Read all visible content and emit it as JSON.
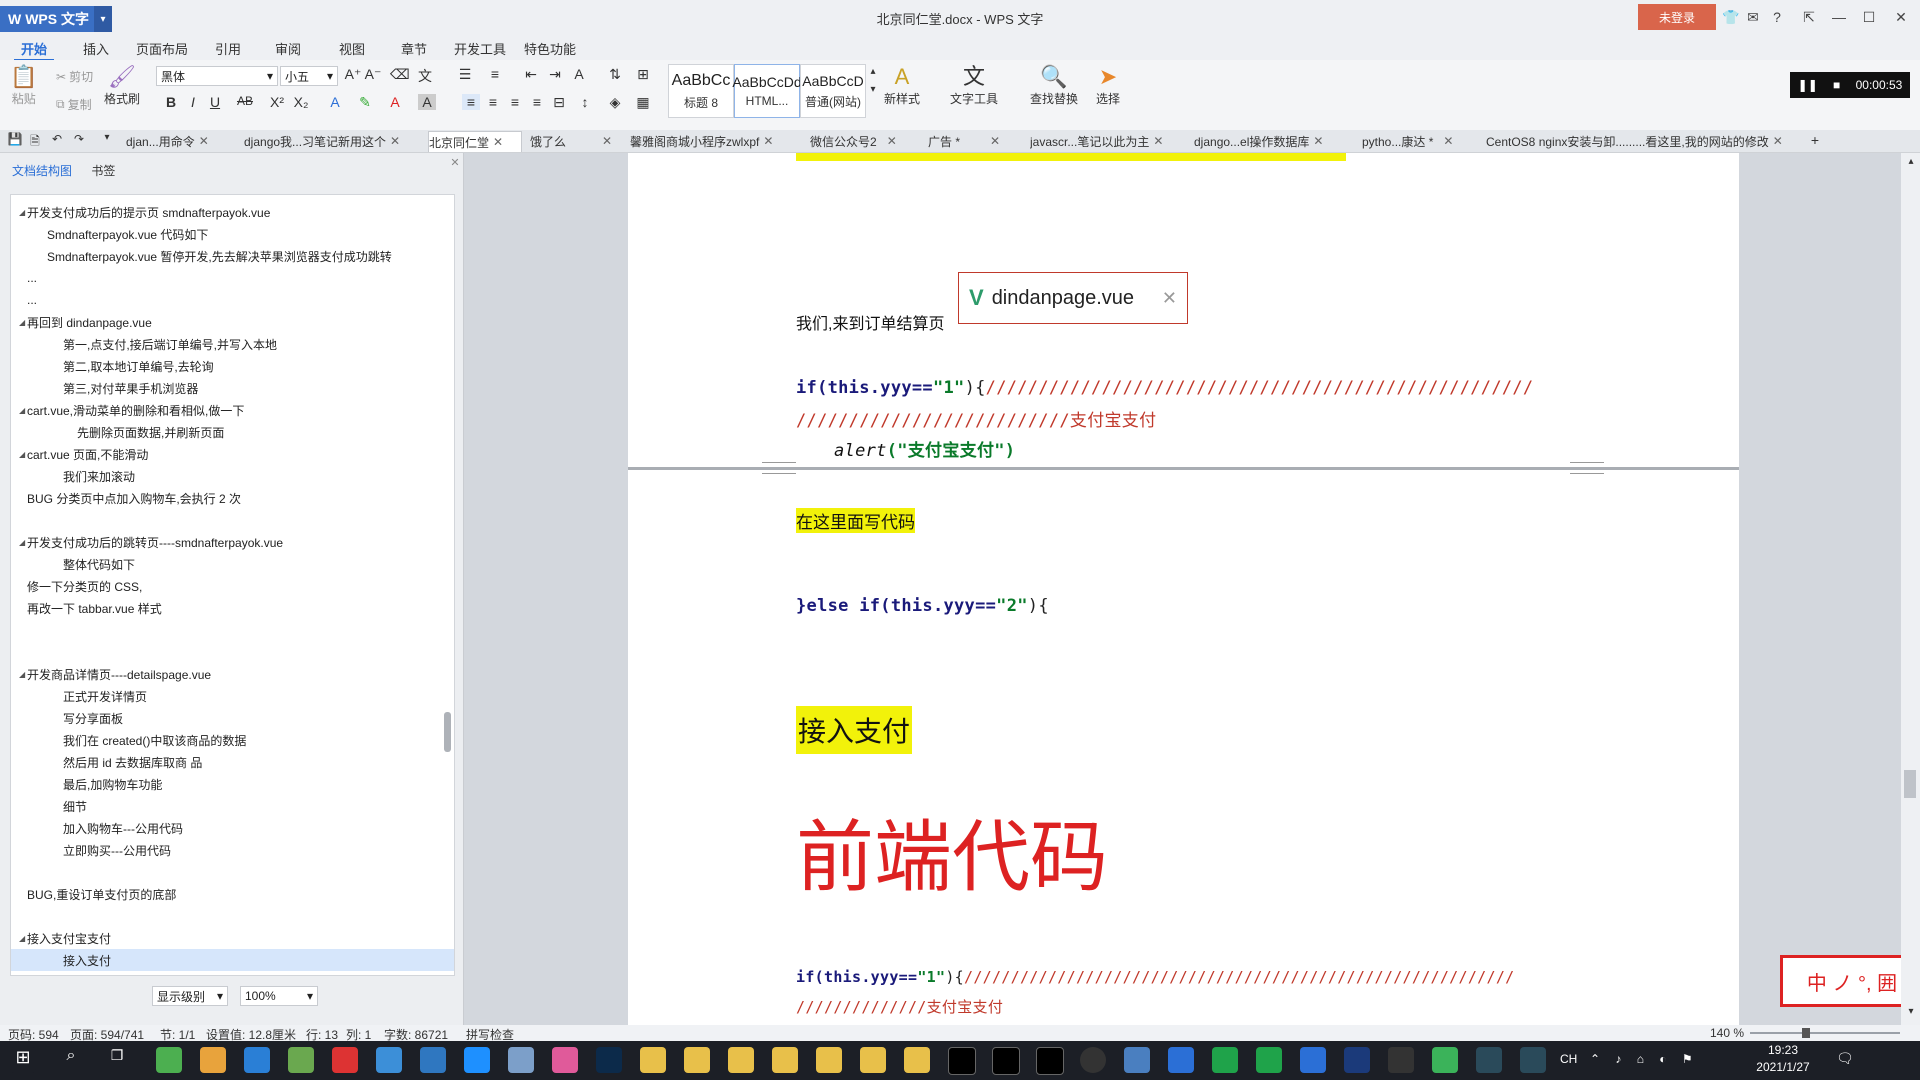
{
  "window": {
    "app_name": "WPS 文字",
    "title": "北京同仁堂.docx - WPS 文字",
    "login_label": "未登录"
  },
  "menu": {
    "tabs": [
      "开始",
      "插入",
      "页面布局",
      "引用",
      "审阅",
      "视图",
      "章节",
      "开发工具",
      "特色功能"
    ]
  },
  "ribbon": {
    "paste": "粘贴",
    "cut": "剪切",
    "copy": "复制",
    "format_painter": "格式刷",
    "font_name": "黑体",
    "font_size": "小五",
    "styles": [
      {
        "sample": "AaBbCc",
        "name": "标题 8"
      },
      {
        "sample": "AaBbCcDd",
        "name": "HTML..."
      },
      {
        "sample": "AaBbCcD",
        "name": "普通(网站)"
      }
    ],
    "new_style": "新样式",
    "text_tools": "文字工具",
    "find_replace": "查找替换",
    "select": "选择",
    "timer": "00:00:53"
  },
  "doc_tabs": [
    "djan...用命令",
    "django我...习笔记新用这个",
    "北京同仁堂",
    "饿了么",
    "馨雅阁商城小程序zwlxpf",
    "微信公众号2",
    "广告 *",
    "javascr...笔记以此为主",
    "django...el操作数据库",
    "pytho...康达 *",
    "CentOS8 nginx安装与卸.........看这里,我的网站的修改"
  ],
  "nav": {
    "tab_outline": "文档结构图",
    "tab_bookmark": "书签",
    "items": [
      {
        "text": "开发支付成功后的提示页        smdnafterpayok.vue",
        "level": 1,
        "expand": true
      },
      {
        "text": "Smdnafterpayok.vue 代码如下",
        "level": 2
      },
      {
        "text": "Smdnafterpayok.vue 暂停开发,先去解决苹果浏览器支付成功跳转",
        "level": 2
      },
      {
        "text": "...",
        "level": 1
      },
      {
        "text": "...",
        "level": 1
      },
      {
        "text": "再回到 dindanpage.vue",
        "level": 1,
        "expand": true
      },
      {
        "text": "第一,点支付,接后端订单编号,并写入本地",
        "level": 3
      },
      {
        "text": "第二,取本地订单编号,去轮询",
        "level": 3
      },
      {
        "text": "第三,对付苹果手机浏览器",
        "level": 3
      },
      {
        "text": "cart.vue,滑动菜单的删除和看相似,做一下",
        "level": 1,
        "expand": true
      },
      {
        "text": "先删除页面数据,并刷新页面",
        "level": 4
      },
      {
        "text": "cart.vue 页面,不能滑动",
        "level": 1,
        "expand": true
      },
      {
        "text": "我们来加滚动",
        "level": 3
      },
      {
        "text": "BUG 分类页中点加入购物车,会执行 2 次",
        "level": 1
      },
      {
        "text": "",
        "level": 1
      },
      {
        "text": "开发支付成功后的跳转页----smdnafterpayok.vue",
        "level": 1,
        "expand": true
      },
      {
        "text": "整体代码如下",
        "level": 3
      },
      {
        "text": "修一下分类页的 CSS,",
        "level": 1
      },
      {
        "text": "再改一下 tabbar.vue 样式",
        "level": 1
      },
      {
        "text": "",
        "level": 1
      },
      {
        "text": "",
        "level": 1
      },
      {
        "text": "开发商品详情页----detailspage.vue",
        "level": 1,
        "expand": true
      },
      {
        "text": "正式开发详情页",
        "level": 3
      },
      {
        "text": "写分享面板",
        "level": 3
      },
      {
        "text": "我们在 created()中取该商品的数据",
        "level": 3
      },
      {
        "text": "然后用 id 去数据库取商  品",
        "level": 3
      },
      {
        "text": "最后,加购物车功能",
        "level": 3
      },
      {
        "text": "细节",
        "level": 3
      },
      {
        "text": "加入购物车---公用代码",
        "level": 3
      },
      {
        "text": "立即购买---公用代码",
        "level": 3
      },
      {
        "text": "",
        "level": 1
      },
      {
        "text": "BUG,重设订单支付页的底部",
        "level": 1
      },
      {
        "text": "",
        "level": 1
      },
      {
        "text": "接入支付宝支付",
        "level": 1,
        "expand": true
      },
      {
        "text": "接入支付",
        "level": 3,
        "selected": true
      }
    ],
    "level_select": "显示级别",
    "zoom_select": "100%"
  },
  "document": {
    "intro": "我们,来到订单结算页",
    "file_chip": "dindanpage.vue",
    "code1_kw": "if",
    "code1_a": "(this.yyy==",
    "code1_str": "\"1\"",
    "code1_b": "){",
    "code1_comment": "////////////////////////////////////////////////////",
    "code1_comment2": "//////////////////////////支付宝支付",
    "alert_fn": "alert",
    "alert_arg": "(\"支付宝支付\")",
    "highlight_note": "在这里面写代码",
    "else_kw": "}else if",
    "else_a": "(this.yyy==",
    "else_str": "\"2\"",
    "else_b": "){",
    "heading": "接入支付",
    "big_red": "前端代码",
    "code2_kw": "if",
    "code2_a": "(this.yyy==",
    "code2_str": "\"1\"",
    "code2_b": "){",
    "code2_comment": "///////////////////////////////////////////////////////////",
    "code2_comment2": "//////////////支付宝支付",
    "seal_text": "中 ノ °, 囲"
  },
  "status": {
    "pages": "页码: 594",
    "page_of": "页面: 594/741",
    "section": "节: 1/1",
    "setting": "设置值: 12.8厘米",
    "row": "行: 13",
    "col": "列: 1",
    "words": "字数: 86721",
    "spellcheck": "拼写检查",
    "zoom": "140 %"
  },
  "taskbar": {
    "ime": "CH",
    "time": "19:23",
    "date": "2021/1/27"
  },
  "colors": {
    "accent": "#2b6fd6",
    "login": "#d9654b",
    "highlight": "#f2f20a",
    "red": "#d22222"
  }
}
